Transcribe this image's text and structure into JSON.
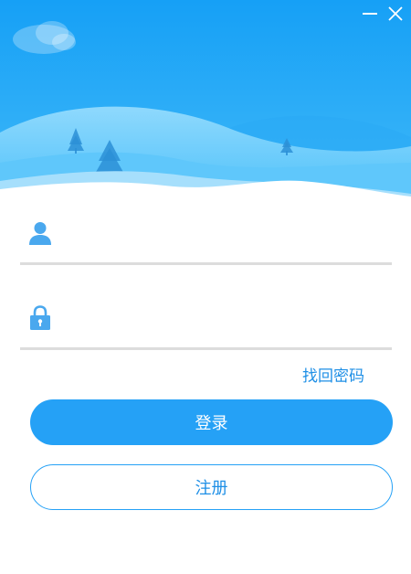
{
  "window": {
    "minimize_glyph": "—",
    "close_glyph": "✕"
  },
  "form": {
    "username_placeholder": "",
    "password_placeholder": "",
    "forgot_password": "找回密码",
    "login_button": "登录",
    "register_button": "注册"
  },
  "icons": {
    "user": "user-icon",
    "lock": "lock-icon",
    "minimize": "minimize-icon",
    "close": "close-icon"
  },
  "colors": {
    "sky_top": "#1aa3f7",
    "sky_bottom": "#3bb6f8",
    "accent": "#25a1f6",
    "link": "#1e8fe6",
    "divider": "#dcdcdc"
  }
}
